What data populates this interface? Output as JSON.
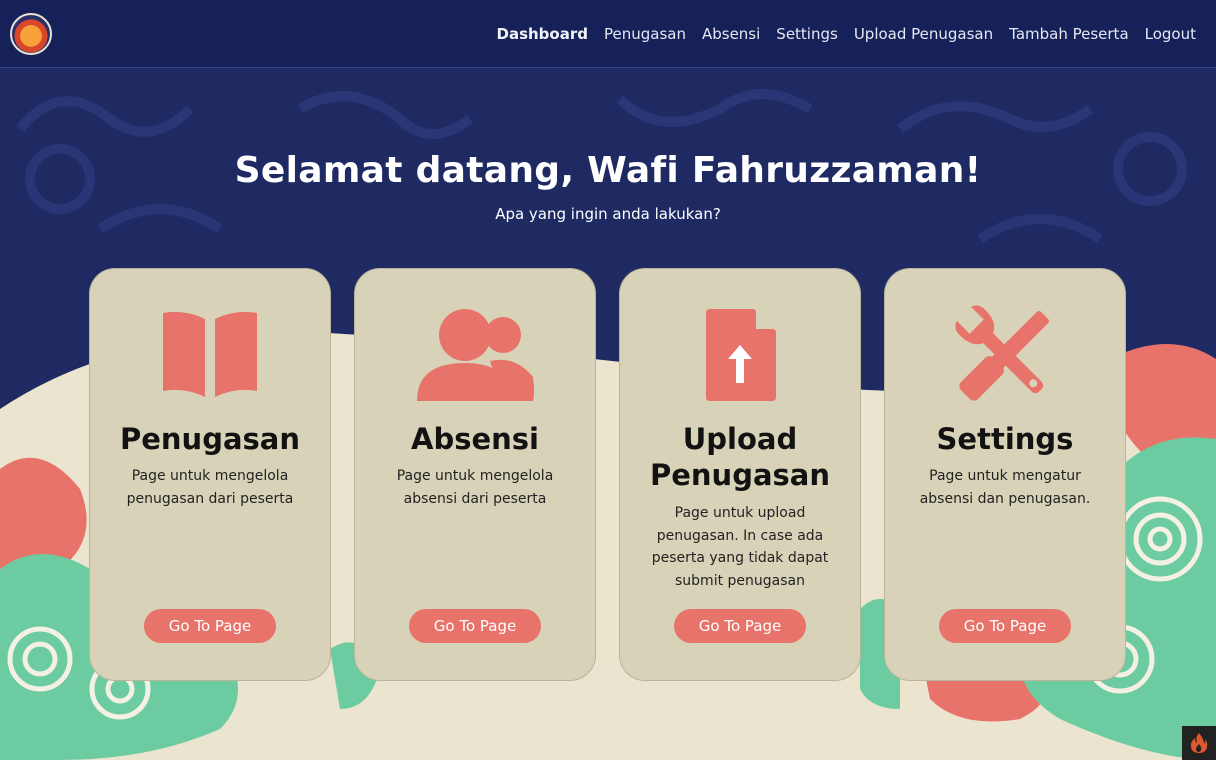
{
  "nav": {
    "links": [
      {
        "label": "Dashboard",
        "active": true
      },
      {
        "label": "Penugasan"
      },
      {
        "label": "Absensi"
      },
      {
        "label": "Settings"
      },
      {
        "label": "Upload Penugasan"
      },
      {
        "label": "Tambah Peserta"
      },
      {
        "label": "Logout"
      }
    ]
  },
  "hero": {
    "title": "Selamat datang, Wafi Fahruzzaman!",
    "subtitle": "Apa yang ingin anda lakukan?"
  },
  "cards": [
    {
      "icon": "book-open-icon",
      "title": "Penugasan",
      "desc": "Page untuk mengelola penugasan dari peserta",
      "button": "Go To Page"
    },
    {
      "icon": "users-icon",
      "title": "Absensi",
      "desc": "Page untuk mengelola absensi dari peserta",
      "button": "Go To Page"
    },
    {
      "icon": "file-upload-icon",
      "title": "Upload Penugasan",
      "desc": "Page untuk upload penugasan. In case ada peserta yang tidak dapat submit penugasan",
      "button": "Go To Page"
    },
    {
      "icon": "tools-icon",
      "title": "Settings",
      "desc": "Page untuk mengatur absensi dan penugasan.",
      "button": "Go To Page"
    }
  ],
  "colors": {
    "navy": "#1f2a63",
    "card": "#d8d3b8",
    "accent": "#e8736a",
    "teal": "#6ccba0",
    "cream": "#ebe5d0"
  }
}
